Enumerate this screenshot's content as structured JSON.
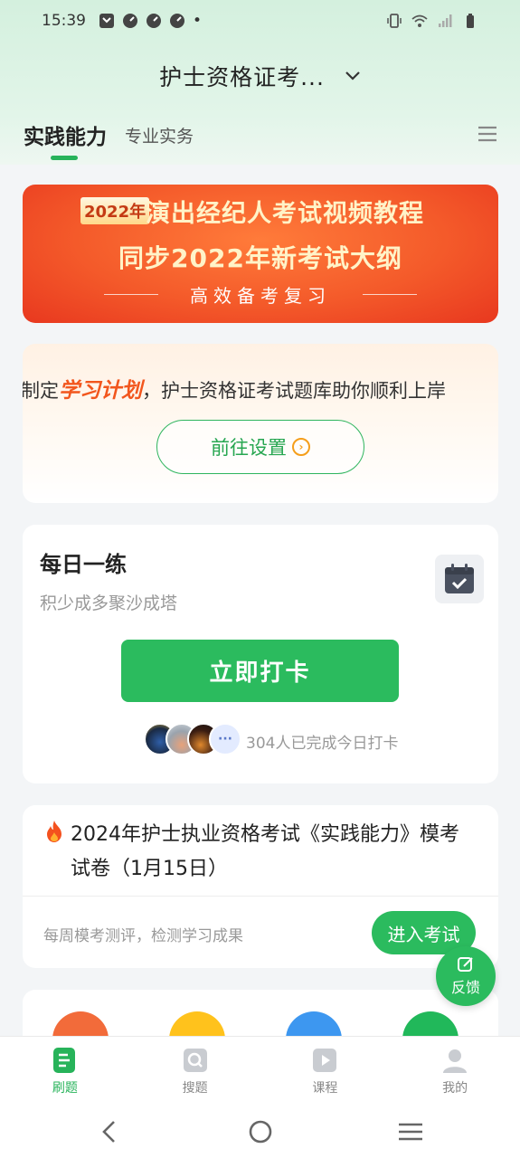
{
  "status_bar": {
    "time": "15:39",
    "dot": "•",
    "icons": [
      "message-icon",
      "notification-icon",
      "notification-icon",
      "notification-icon",
      "vibrate-icon",
      "wifi-icon",
      "signal-icon",
      "battery-icon"
    ]
  },
  "header": {
    "title": "护士资格证考...",
    "dropdown_icon": "chevron-down-icon"
  },
  "tabs": {
    "active": "实践能力",
    "inactive": "专业实务",
    "menu_icon": "menu-icon",
    "accent_color": "#27b35a"
  },
  "banner": {
    "badge": "2022年",
    "line1": "演出经纪人考试视频教程",
    "line2": "同步2022年新考试大纲",
    "line3": "高效备考复习"
  },
  "plan_card": {
    "text_prefix": "制定",
    "text_highlight": "学习计划",
    "text_suffix": "，护士资格证考试题库助你顺利上岸",
    "button": "前往设置"
  },
  "daily": {
    "title": "每日一练",
    "subtitle": "积少成多聚沙成塔",
    "checkin_button": "立即打卡",
    "more": "···",
    "count_text": "304人已完成今日打卡"
  },
  "exam": {
    "title": "2024年护士执业资格考试《实践能力》模考试卷（1月15日）",
    "subtitle": "每周模考测评，检测学习成果",
    "button": "进入考试"
  },
  "feedback": {
    "label": "反馈"
  },
  "bottom_nav": {
    "items": [
      {
        "label": "刷题",
        "icon": "practice-icon"
      },
      {
        "label": "搜题",
        "icon": "search-question-icon"
      },
      {
        "label": "课程",
        "icon": "video-course-icon"
      },
      {
        "label": "我的",
        "icon": "profile-icon"
      }
    ]
  },
  "colors": {
    "brand_green": "#2bbb5e",
    "banner_orange": "#f45a2a",
    "highlight_orange": "#f2561d"
  }
}
